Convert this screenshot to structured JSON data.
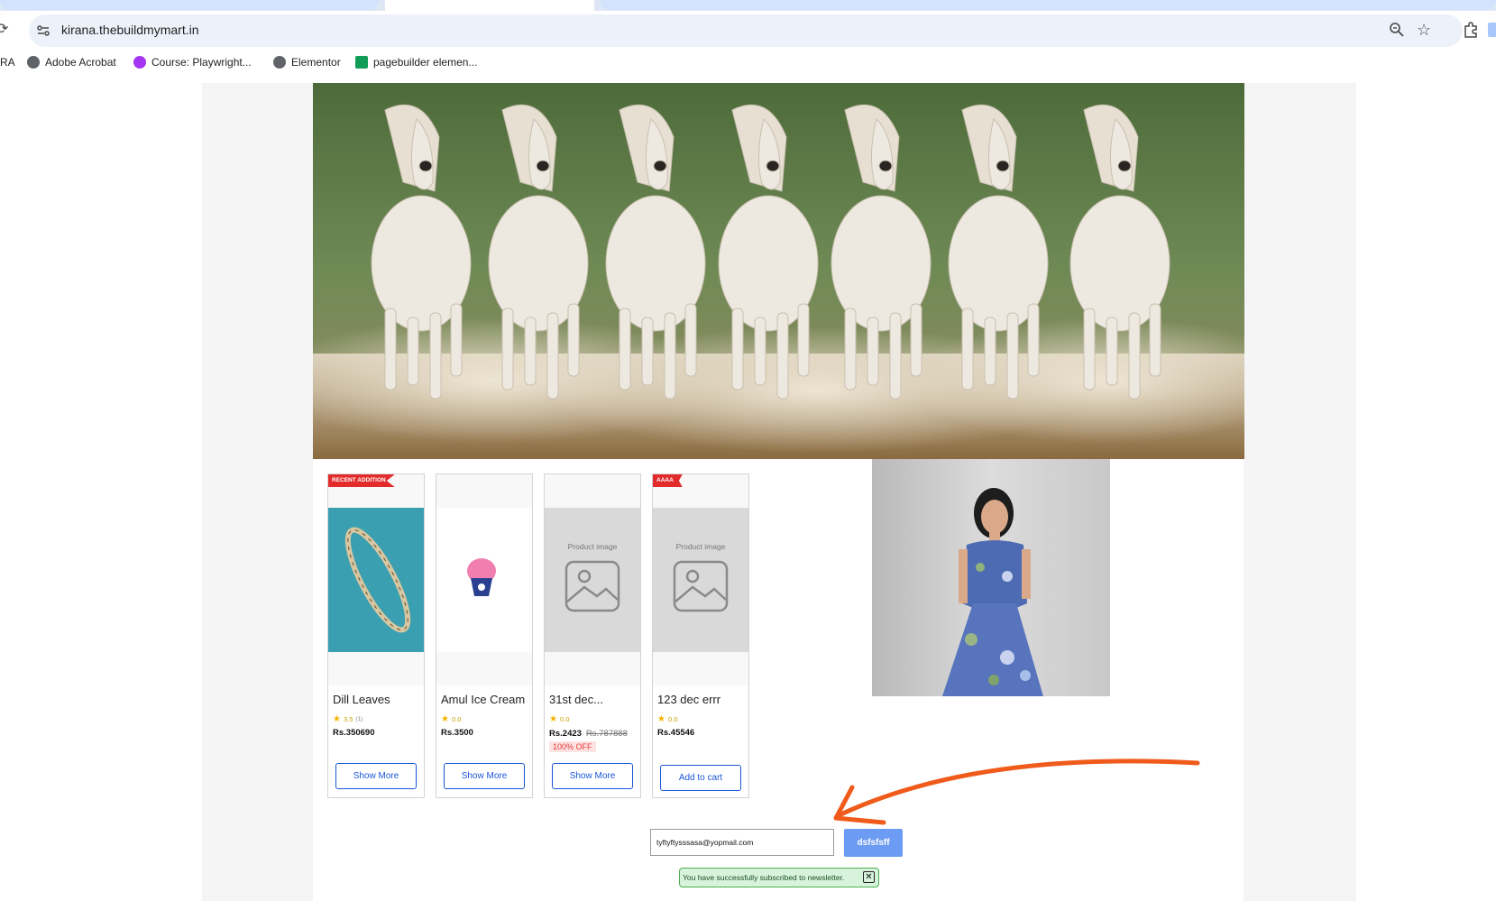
{
  "browser": {
    "url": "kirana.thebuildmymart.in",
    "bookmarks": [
      {
        "label": "RA",
        "icon": "none"
      },
      {
        "label": "Adobe Acrobat",
        "icon": "globe-icon"
      },
      {
        "label": "Course: Playwright...",
        "icon": "udemy-icon"
      },
      {
        "label": "Elementor",
        "icon": "globe-icon"
      },
      {
        "label": "pagebuilder elemen...",
        "icon": "sheets-icon"
      }
    ]
  },
  "products": [
    {
      "ribbon": "RECENT ADDITION",
      "name": "Dill Leaves",
      "rating": "3.5",
      "rating_count": "(1)",
      "price": "Rs.350690",
      "old_price": "",
      "discount": "",
      "button": "Show More",
      "image": "bangle"
    },
    {
      "ribbon": "",
      "name": "Amul Ice Cream",
      "rating": "0.0",
      "rating_count": "",
      "price": "Rs.3500",
      "old_price": "",
      "discount": "",
      "button": "Show More",
      "image": "icecream"
    },
    {
      "ribbon": "",
      "name": "31st dec...",
      "rating": "0.0",
      "rating_count": "",
      "price": "Rs.2423",
      "old_price": "Rs.787888",
      "discount": "100% OFF",
      "button": "Show More",
      "image": "placeholder",
      "placeholder_text": "Product image"
    },
    {
      "ribbon": "AAAA",
      "name": "123 dec errr",
      "rating": "0.0",
      "rating_count": "",
      "price": "Rs.45546",
      "old_price": "",
      "discount": "",
      "button": "Add to cart",
      "image": "placeholder",
      "placeholder_text": "Product image"
    }
  ],
  "newsletter": {
    "email_value": "tyftyftysssasa@yopmail.com",
    "button_label": "dsfsfsff",
    "success_message": "You have successfully subscribed to newsletter.",
    "close_label": "✕"
  },
  "colors": {
    "accent": "#1a56db",
    "ribbon": "#e32b2b",
    "annotation_arrow": "#f05a1a",
    "success_bg": "#d8f3dc"
  }
}
